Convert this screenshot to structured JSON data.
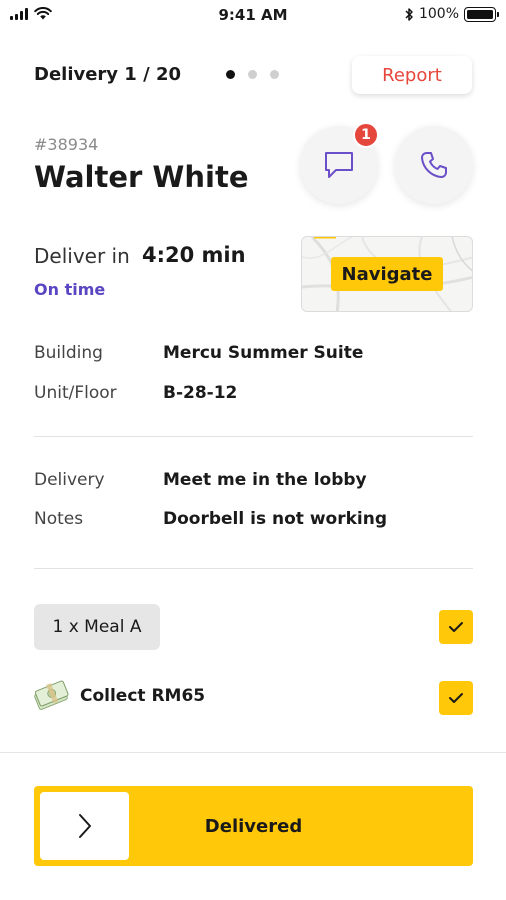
{
  "status_bar": {
    "time": "9:41 AM",
    "battery": "100%",
    "battery_level": 1.0
  },
  "header": {
    "title": "Delivery 1 / 20",
    "page_count": 3,
    "active_page": 1,
    "report_label": "Report"
  },
  "customer": {
    "order_id": "#38934",
    "name": "Walter White",
    "unread_messages": "1",
    "chat_icon": "chat-bubble-icon",
    "call_icon": "phone-icon"
  },
  "delivery_time": {
    "label": "Deliver in",
    "value": "4:20 min",
    "status": "On time"
  },
  "map": {
    "navigate_label": "Navigate"
  },
  "address": {
    "building_label": "Building",
    "building_value": "Mercu Summer Suite",
    "unit_label": "Unit/Floor",
    "unit_value": "B-28-12"
  },
  "notes": {
    "delivery_label": "Delivery",
    "delivery_value": "Meet me in the lobby",
    "notes_label": "Notes",
    "notes_value": "Doorbell is not working"
  },
  "items": {
    "meal_label": "1 x Meal A",
    "meal_checked": true,
    "collect_label": "Collect RM65",
    "collect_checked": true
  },
  "slide_action": {
    "label": "Delivered"
  },
  "colors": {
    "accent_yellow": "#ffc808",
    "report_red": "#e5473d",
    "status_purple": "#5a46c2",
    "icon_purple": "#6b4fc8"
  }
}
